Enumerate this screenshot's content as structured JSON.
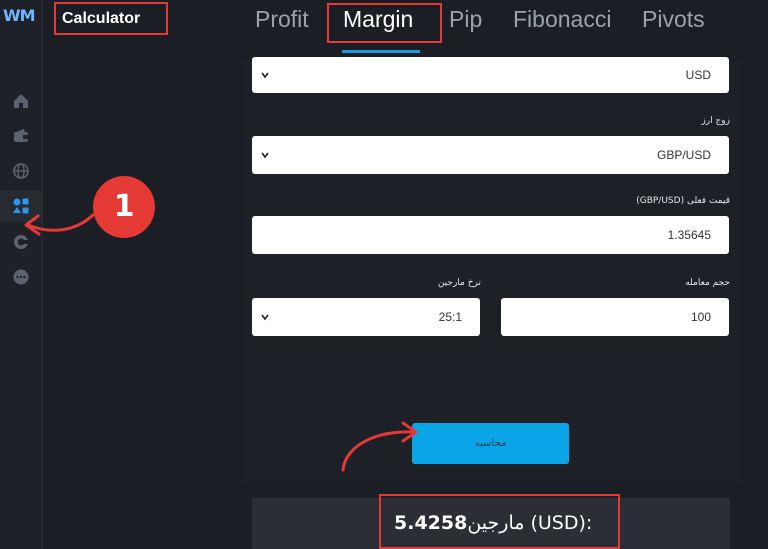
{
  "brand": {
    "logo": "WM"
  },
  "sidebar": {
    "title": "Calculator"
  },
  "rail": {
    "icons": [
      "home-icon",
      "wallet-icon",
      "globe-icon",
      "apps-icon",
      "coin-icon",
      "more-icon"
    ]
  },
  "tabs": [
    {
      "label": "Profit"
    },
    {
      "label": "Margin"
    },
    {
      "label": "Pip"
    },
    {
      "label": "Fibonacci"
    },
    {
      "label": "Pivots"
    }
  ],
  "active_tab": "Margin",
  "form": {
    "account_currency": {
      "value": "USD"
    },
    "currency_pair": {
      "label": "زوج ارز",
      "value": "GBP/USD"
    },
    "current_price": {
      "label": "قیمت فعلی (GBP/USD)",
      "value": "1.35645"
    },
    "trade_volume": {
      "label": "حجم معامله",
      "value": "100"
    },
    "margin_ratio": {
      "label": "نرخ مارجین",
      "value": "25:1"
    },
    "calculate_label": "محاسبه"
  },
  "result": {
    "prefix": "مارجین (USD):",
    "value": "5.4258"
  },
  "annotation": {
    "step_number": "1"
  },
  "colors": {
    "accent": "#0aa5e6",
    "highlight": "#e53935",
    "background": "#1b1e25"
  }
}
